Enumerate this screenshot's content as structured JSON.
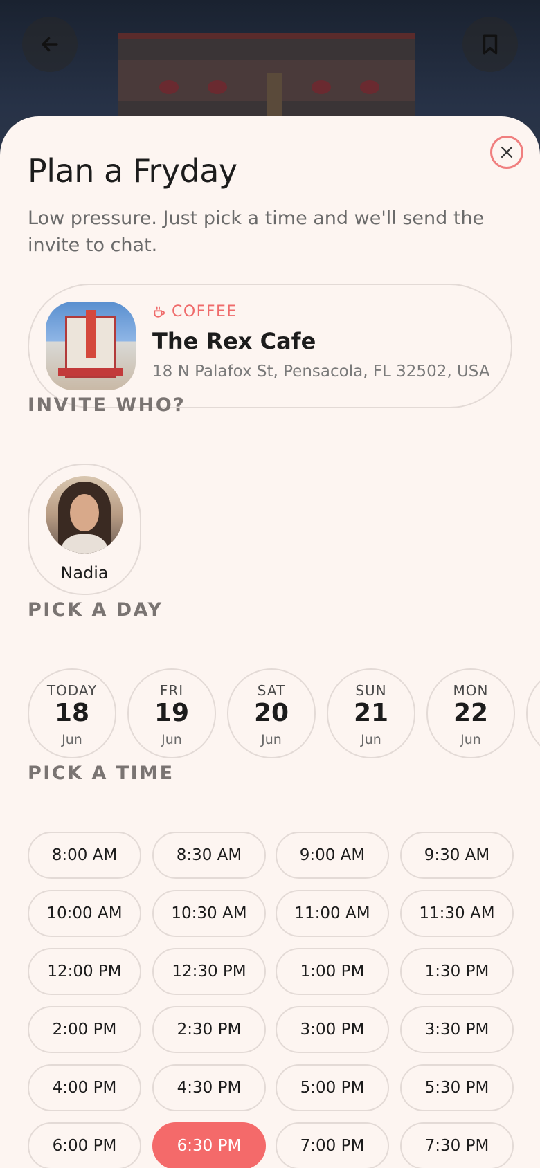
{
  "header": {
    "back_icon": "arrow-left-icon",
    "bookmark_icon": "bookmark-icon"
  },
  "sheet": {
    "close_icon": "close-icon",
    "title": "Plan a Fryday",
    "subtitle": "Low pressure. Just pick a time and we'll send the invite to chat."
  },
  "venue": {
    "category_icon": "coffee-icon",
    "category": "COFFEE",
    "name": "The Rex Cafe",
    "address": "18 N Palafox St, Pensacola, FL 32502, USA"
  },
  "invite": {
    "label": "INVITE WHO?",
    "people": [
      {
        "name": "Nadia"
      }
    ]
  },
  "day": {
    "label": "PICK A DAY",
    "days": [
      {
        "dow": "TODAY",
        "num": "18",
        "mon": "Jun"
      },
      {
        "dow": "FRI",
        "num": "19",
        "mon": "Jun"
      },
      {
        "dow": "SAT",
        "num": "20",
        "mon": "Jun"
      },
      {
        "dow": "SUN",
        "num": "21",
        "mon": "Jun"
      },
      {
        "dow": "MON",
        "num": "22",
        "mon": "Jun"
      }
    ]
  },
  "time": {
    "label": "PICK A TIME",
    "selected": "6:30 PM",
    "slots": [
      "8:00 AM",
      "8:30 AM",
      "9:00 AM",
      "9:30 AM",
      "10:00 AM",
      "10:30 AM",
      "11:00 AM",
      "11:30 AM",
      "12:00 PM",
      "12:30 PM",
      "1:00 PM",
      "1:30 PM",
      "2:00 PM",
      "2:30 PM",
      "3:00 PM",
      "3:30 PM",
      "4:00 PM",
      "4:30 PM",
      "5:00 PM",
      "5:30 PM",
      "6:00 PM",
      "6:30 PM",
      "7:00 PM",
      "7:30 PM"
    ]
  },
  "colors": {
    "accent": "#f46a6a",
    "background": "#fdf5f1",
    "text": "#1c1c1c",
    "muted": "#7a7a7a"
  }
}
